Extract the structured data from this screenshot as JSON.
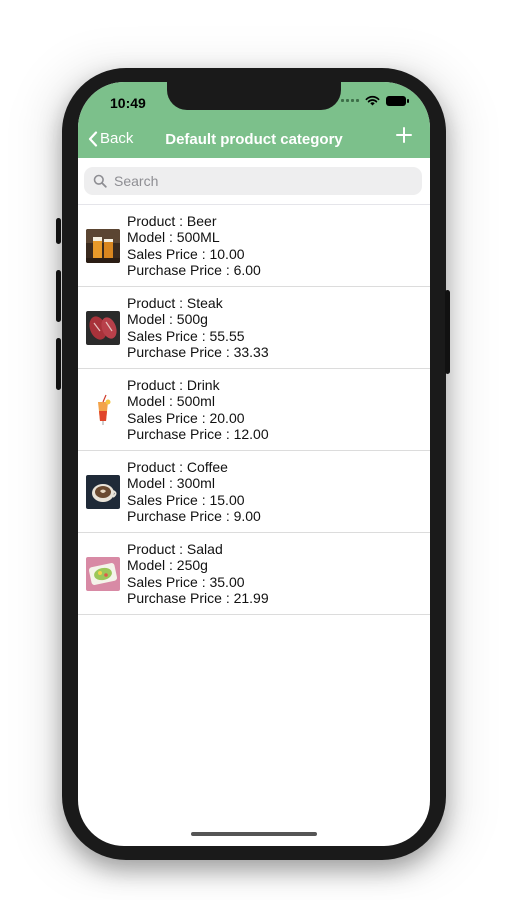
{
  "status_bar": {
    "time": "10:49",
    "icons": [
      "signal-icon",
      "wifi-icon",
      "battery-icon"
    ]
  },
  "nav": {
    "back_label": "Back",
    "title": "Default product category",
    "add_icon": "plus-icon",
    "color": "#7cc08b"
  },
  "search": {
    "placeholder": "Search",
    "value": ""
  },
  "products": [
    {
      "product": "Product : Beer",
      "model": "Model : 500ML",
      "sales_price": "Sales Price : 10.00",
      "purchase_price": "Purchase Price : 6.00",
      "icon": "beer-image"
    },
    {
      "product": "Product : Steak",
      "model": "Model : 500g",
      "sales_price": "Sales Price : 55.55",
      "purchase_price": "Purchase Price : 33.33",
      "icon": "steak-image"
    },
    {
      "product": "Product : Drink",
      "model": "Model : 500ml",
      "sales_price": "Sales Price : 20.00",
      "purchase_price": "Purchase Price : 12.00",
      "icon": "drink-image"
    },
    {
      "product": "Product : Coffee",
      "model": "Model : 300ml",
      "sales_price": "Sales Price : 15.00",
      "purchase_price": "Purchase Price : 9.00",
      "icon": "coffee-image"
    },
    {
      "product": "Product : Salad",
      "model": "Model : 250g",
      "sales_price": "Sales Price : 35.00",
      "purchase_price": "Purchase Price : 21.99",
      "icon": "salad-image"
    }
  ]
}
